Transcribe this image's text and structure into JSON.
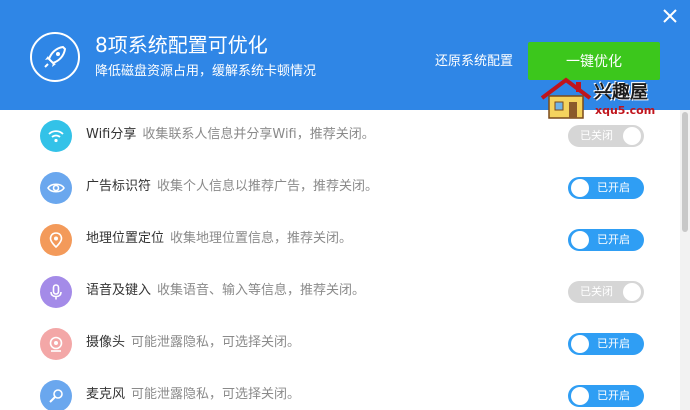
{
  "header": {
    "title": "8项系统配置可优化",
    "subtitle": "降低磁盘资源占用，缓解系统卡顿情况",
    "restore_label": "还原系统配置",
    "optimize_label": "一键优化",
    "bg_color": "#2f86e6",
    "button_color": "#3cc71c"
  },
  "watermark": {
    "name": "兴趣屋",
    "site": "xqu5.com"
  },
  "items": [
    {
      "name": "Wifi分享",
      "desc": "收集联系人信息并分享Wifi，推荐关闭。",
      "state": "已关闭",
      "on": false,
      "icon": "wifi-icon",
      "icon_color": "#33c2e8"
    },
    {
      "name": "广告标识符",
      "desc": "收集个人信息以推荐广告，推荐关闭。",
      "state": "已开启",
      "on": true,
      "icon": "eye-icon",
      "icon_color": "#6aa7ee"
    },
    {
      "name": "地理位置定位",
      "desc": "收集地理位置信息，推荐关闭。",
      "state": "已开启",
      "on": true,
      "icon": "location-pin-icon",
      "icon_color": "#f39a5a"
    },
    {
      "name": "语音及键入",
      "desc": "收集语音、输入等信息，推荐关闭。",
      "state": "已关闭",
      "on": false,
      "icon": "microphone-icon",
      "icon_color": "#a48be8"
    },
    {
      "name": "摄像头",
      "desc": "可能泄露隐私，可选择关闭。",
      "state": "已开启",
      "on": true,
      "icon": "camera-icon",
      "icon_color": "#f3a7a7"
    },
    {
      "name": "麦克风",
      "desc": "可能泄露隐私，可选择关闭。",
      "state": "已开启",
      "on": true,
      "icon": "mic-icon",
      "icon_color": "#6aa7ee"
    }
  ]
}
